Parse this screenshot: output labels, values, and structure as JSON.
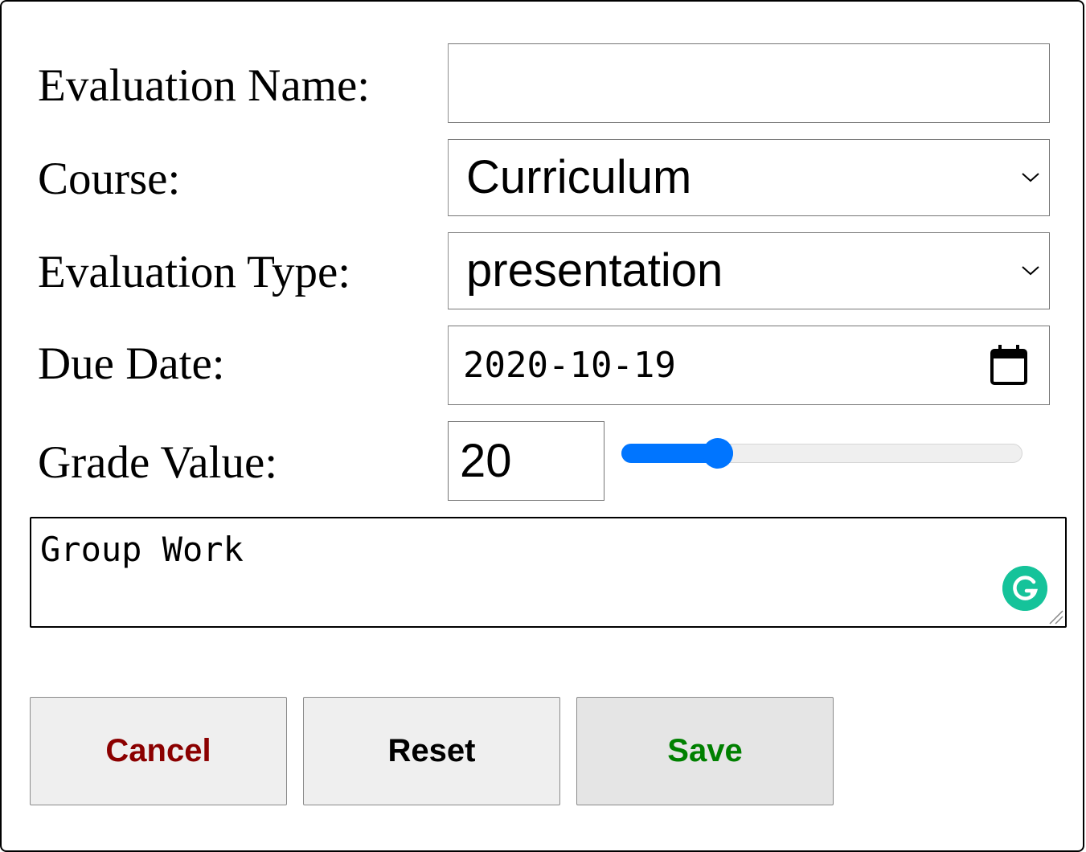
{
  "form": {
    "evaluation_name": {
      "label": "Evaluation Name:",
      "value": ""
    },
    "course": {
      "label": "Course:",
      "selected": "Curriculum"
    },
    "evaluation_type": {
      "label": "Evaluation Type:",
      "selected": "presentation"
    },
    "due_date": {
      "label": "Due Date:",
      "value": "2020-10-19"
    },
    "grade_value": {
      "label": "Grade Value:",
      "value": "20",
      "slider_fraction": 0.24
    },
    "notes": {
      "value": "Group Work"
    }
  },
  "buttons": {
    "cancel_label": "Cancel",
    "reset_label": "Reset",
    "save_label": "Save"
  },
  "colors": {
    "cancel_text": "#8b0000",
    "save_text": "#008000",
    "slider_accent": "#0075ff",
    "grammarly": "#15c39a"
  },
  "icons": {
    "select_chevron": "chevron-down-icon",
    "date_picker": "calendar-icon",
    "assistant": "grammarly-icon",
    "textarea_resize": "resize-handle-icon"
  }
}
